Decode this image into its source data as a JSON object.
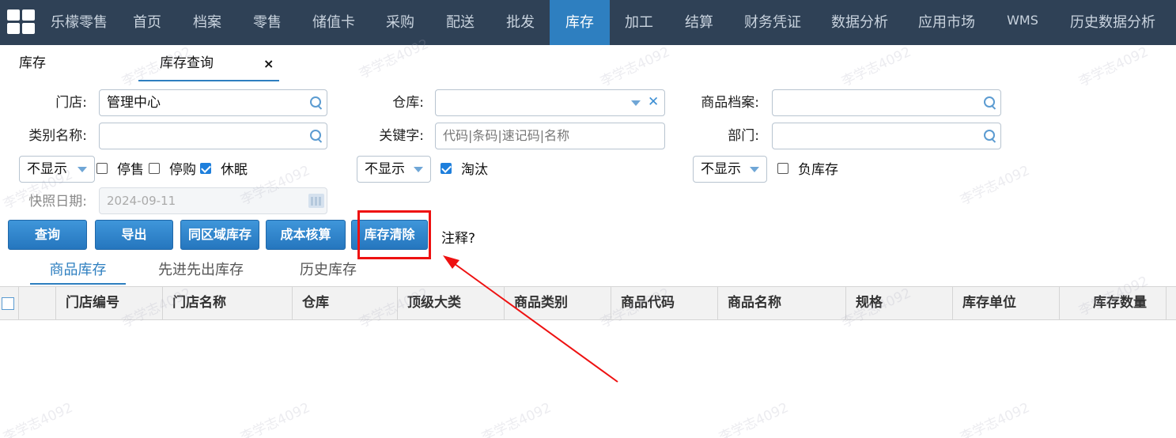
{
  "nav": {
    "brand": "乐檬零售",
    "items": [
      "首页",
      "档案",
      "零售",
      "储值卡",
      "采购",
      "配送",
      "批发",
      "库存",
      "加工",
      "结算",
      "财务凭证",
      "数据分析",
      "应用市场",
      "WMS",
      "历史数据分析"
    ],
    "active_item": "库存"
  },
  "tabs": {
    "module": "库存",
    "page": "库存查询",
    "close_symbol": "×"
  },
  "form": {
    "store_label": "门店:",
    "store_value": "管理中心",
    "warehouse_label": "仓库:",
    "warehouse_value": "",
    "product_label": "商品档案:",
    "product_value": "",
    "category_label": "类别名称:",
    "category_value": "",
    "keyword_label": "关键字:",
    "keyword_placeholder": "代码|条码|速记码|名称",
    "dept_label": "部门:",
    "dept_value": "",
    "select1": "不显示",
    "select2": "不显示",
    "select3": "不显示",
    "check_stop_sale": "停售",
    "check_stop_sale_checked": false,
    "check_stop_purchase": "停购",
    "check_stop_purchase_checked": false,
    "check_dormant": "休眠",
    "check_dormant_checked": true,
    "check_eliminated": "淘汰",
    "check_eliminated_checked": true,
    "check_negative": "负库存",
    "check_negative_checked": false,
    "snapshot_label": "快照日期:",
    "snapshot_value": "2024-09-11"
  },
  "actions": {
    "query": "查询",
    "export": "导出",
    "same_region": "同区域库存",
    "cost_check": "成本核算",
    "clear_stock": "库存清除",
    "note": "注释?"
  },
  "subtabs": [
    "商品库存",
    "先进先出库存",
    "历史库存"
  ],
  "grid": {
    "columns": [
      "门店编号",
      "门店名称",
      "仓库",
      "顶级大类",
      "商品类别",
      "商品代码",
      "商品名称",
      "规格",
      "库存单位",
      "库存数量"
    ]
  },
  "watermark": "李学志4092",
  "colors": {
    "nav_bg": "#2f4156",
    "accent": "#2e7fc0",
    "highlight": "#ee1111"
  }
}
